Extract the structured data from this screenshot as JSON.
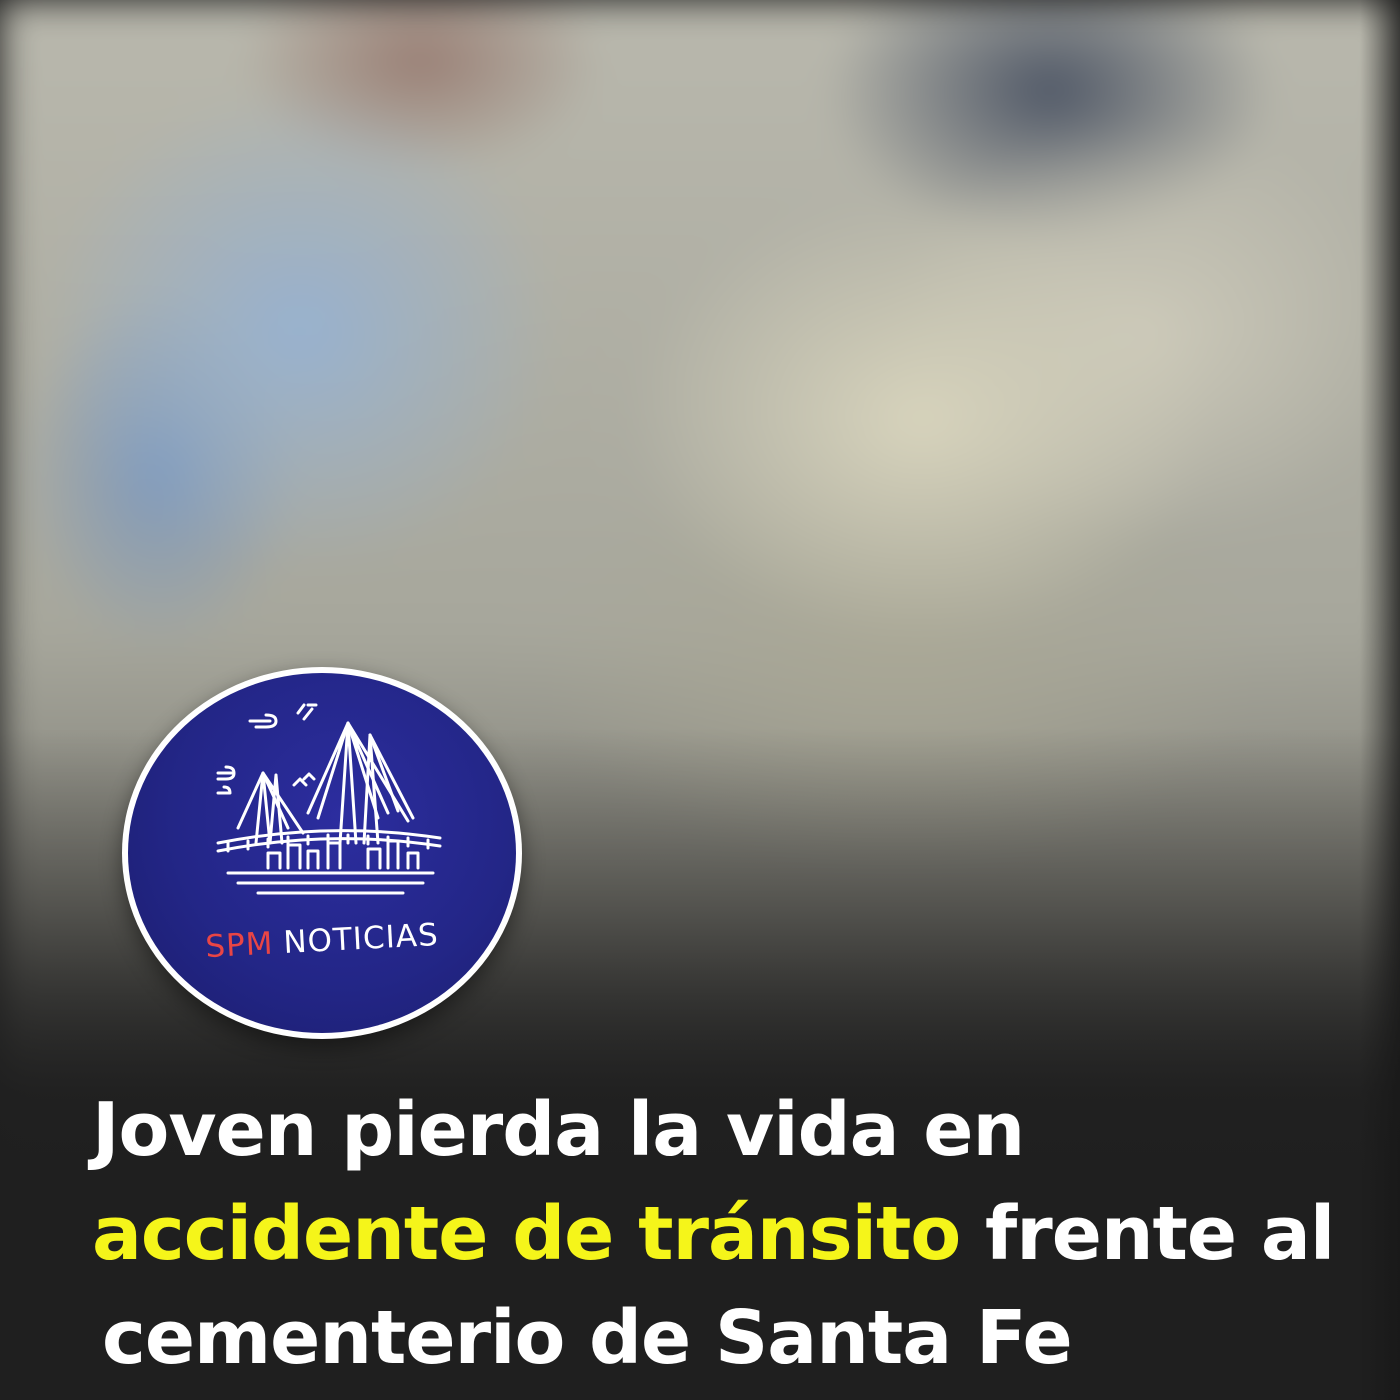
{
  "logo": {
    "name_part1": "SPM",
    "name_part2": "NOTICIAS",
    "icon": "bridge-skyline-icon",
    "colors": {
      "background": "#232687",
      "accent": "#e94545",
      "text": "#ffffff"
    }
  },
  "headline": {
    "line1": "Joven pierda la vida en",
    "line2_highlight": "accidente de tránsito",
    "line2_rest": "frente al",
    "line3": "cementerio de Santa Fe",
    "colors": {
      "text": "#ffffff",
      "highlight": "#f5f51a",
      "background": "#1f1f1f"
    }
  },
  "background_image": "blurred-accident-photo"
}
